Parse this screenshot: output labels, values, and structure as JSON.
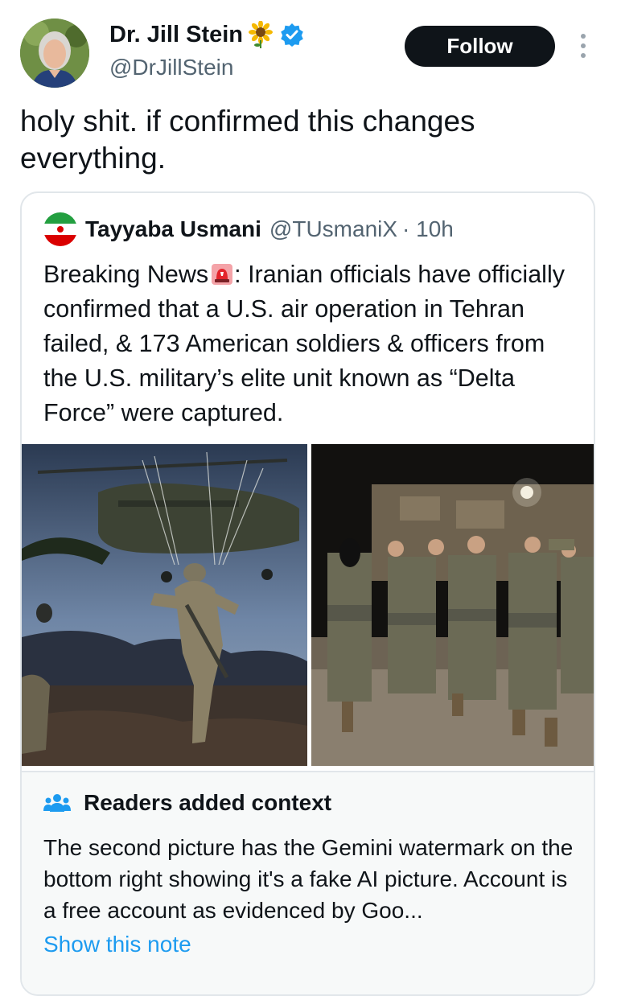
{
  "author": {
    "name": "Dr. Jill Stein",
    "handle": "@DrJillStein",
    "follow_label": "Follow"
  },
  "tweet": {
    "text": "holy shit. if confirmed this changes everything."
  },
  "quoted_tweet": {
    "name": "Tayyaba Usmani",
    "handle": "@TUsmaniX",
    "time": "· 10h",
    "text_before": "Breaking News",
    "text_after": ": Iranian officials have officially confirmed that a U.S. air operation in Tehran failed, & 173 American soldiers & officers from the U.S. military’s elite unit known as “Delta Force” were captured."
  },
  "community_note": {
    "title": "Readers added context",
    "text": "The second picture has the Gemini watermark on the bottom right showing it's a fake AI picture. Account is a free account as evidenced by Goo...",
    "link_label": "Show this note"
  },
  "colors": {
    "accent": "#1d9bf0",
    "text": "#0f1419",
    "secondary": "#536471",
    "follow_bg": "#0f1419"
  },
  "icons": [
    "sunflower-icon",
    "verified-badge-icon",
    "more-options-icon",
    "siren-icon",
    "readers-context-icon"
  ]
}
